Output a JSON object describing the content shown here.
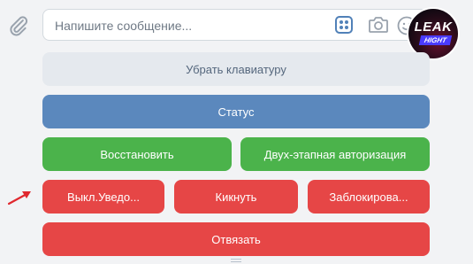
{
  "composer": {
    "placeholder": "Напишите сообщение...",
    "icons": {
      "attach": "paperclip-icon",
      "keyboard": "keyboard-icon",
      "camera": "camera-icon",
      "emoji": "smile-icon"
    }
  },
  "logo": {
    "line1": "LEAK",
    "line2": "HIGHT"
  },
  "keyboard": {
    "hide": "Убрать клавиатуру",
    "status": "Статус",
    "restore": "Восстановить",
    "two_factor": "Двух-этапная авторизация",
    "notifications_off": "Выкл.Уведо...",
    "kick": "Кикнуть",
    "block": "Заблокирова...",
    "unlink": "Отвязать"
  },
  "colors": {
    "primary": "#5b88bd",
    "positive": "#4bb34b",
    "negative": "#e64646",
    "secondary": "#e5e9ee",
    "annotation_arrow": "#e0282e"
  },
  "annotation": {
    "arrow_icon": "red-arrow-pointer-icon"
  }
}
